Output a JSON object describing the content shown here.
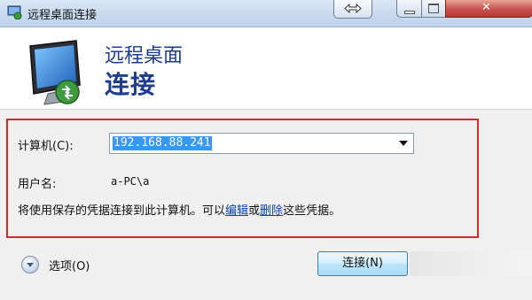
{
  "window": {
    "title": "远程桌面连接"
  },
  "header": {
    "line1": "远程桌面",
    "line2": "连接"
  },
  "form": {
    "computer_label": "计算机(C):",
    "computer_value": "192.168.88.241",
    "username_label": "用户名:",
    "username_value": "a-PC\\a",
    "info_prefix": "将使用保存的凭据连接到此计算机。可以",
    "info_edit": "编辑",
    "info_or": "或",
    "info_delete": "删除",
    "info_suffix": "这些凭据。"
  },
  "footer": {
    "options_label": "选项(O)",
    "connect_label": "连接(N)"
  },
  "colors": {
    "highlight": "#d02a2a",
    "title_blue": "#1e3c8c",
    "selection": "#3399ff"
  },
  "icons": [
    "rdp-app-icon",
    "swap-arrows-icon",
    "monitor-connection-icon",
    "options-expand-icon"
  ]
}
